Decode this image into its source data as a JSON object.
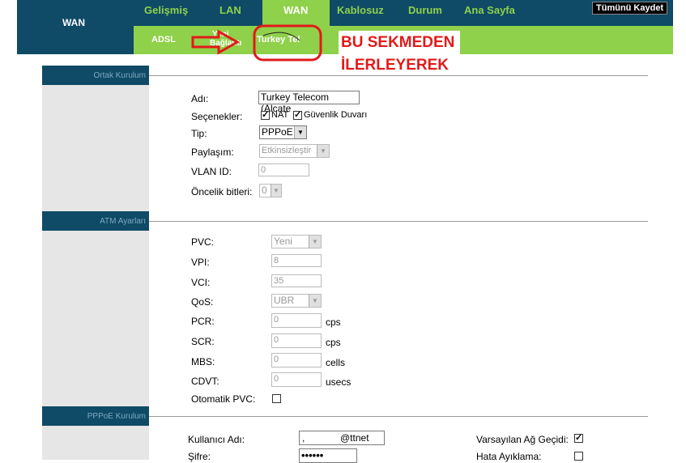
{
  "header": {
    "brand": "WAN",
    "tabs": [
      "Gelişmiş",
      "LAN",
      "WAN",
      "Kablosuz",
      "Durum",
      "Ana Sayfa"
    ],
    "save_all": "Tümünü Kaydet"
  },
  "subnav": {
    "items": [
      "ADSL",
      "Yeni",
      "Bağlantı",
      "Turkey Tel"
    ]
  },
  "annotation": {
    "line1": "BU SEKMEDEN",
    "line2": "İLERLEYEREK",
    "color": "#e11a1a"
  },
  "sections": {
    "general": "Ortak Kurulum",
    "atm": "ATM Ayarları",
    "pppoe": "PPPoE Kurulum"
  },
  "general": {
    "name_label": "Adı:",
    "name_value": "Turkey Telecom (Alcate",
    "options_label": "Seçenekler:",
    "nat_label": "NAT",
    "firewall_label": "Güvenlik Duvarı",
    "type_label": "Tip:",
    "type_value": "PPPoE",
    "sharing_label": "Paylaşım:",
    "sharing_value": "Etkinsizleştir",
    "vlan_label": "VLAN ID:",
    "vlan_value": "0",
    "priority_label": "Öncelik bitleri:",
    "priority_value": "0"
  },
  "atm": {
    "pvc_label": "PVC:",
    "pvc_value": "Yeni",
    "vpi_label": "VPI:",
    "vpi_value": "8",
    "vci_label": "VCI:",
    "vci_value": "35",
    "qos_label": "QoS:",
    "qos_value": "UBR",
    "pcr_label": "PCR:",
    "pcr_value": "0",
    "pcr_unit": "cps",
    "scr_label": "SCR:",
    "scr_value": "0",
    "scr_unit": "cps",
    "mbs_label": "MBS:",
    "mbs_value": "0",
    "mbs_unit": "cells",
    "cdvt_label": "CDVT:",
    "cdvt_value": "0",
    "cdvt_unit": "usecs",
    "auto_pvc_label": "Otomatik PVC:"
  },
  "pppoe": {
    "username_label": "Kullanıcı Adı:",
    "username_value": "@ttnet",
    "password_label": "Şifre:",
    "password_value": "••••••",
    "default_gw_label": "Varsayılan Ağ Geçidi:",
    "debug_label": "Hata Ayıklama:"
  }
}
